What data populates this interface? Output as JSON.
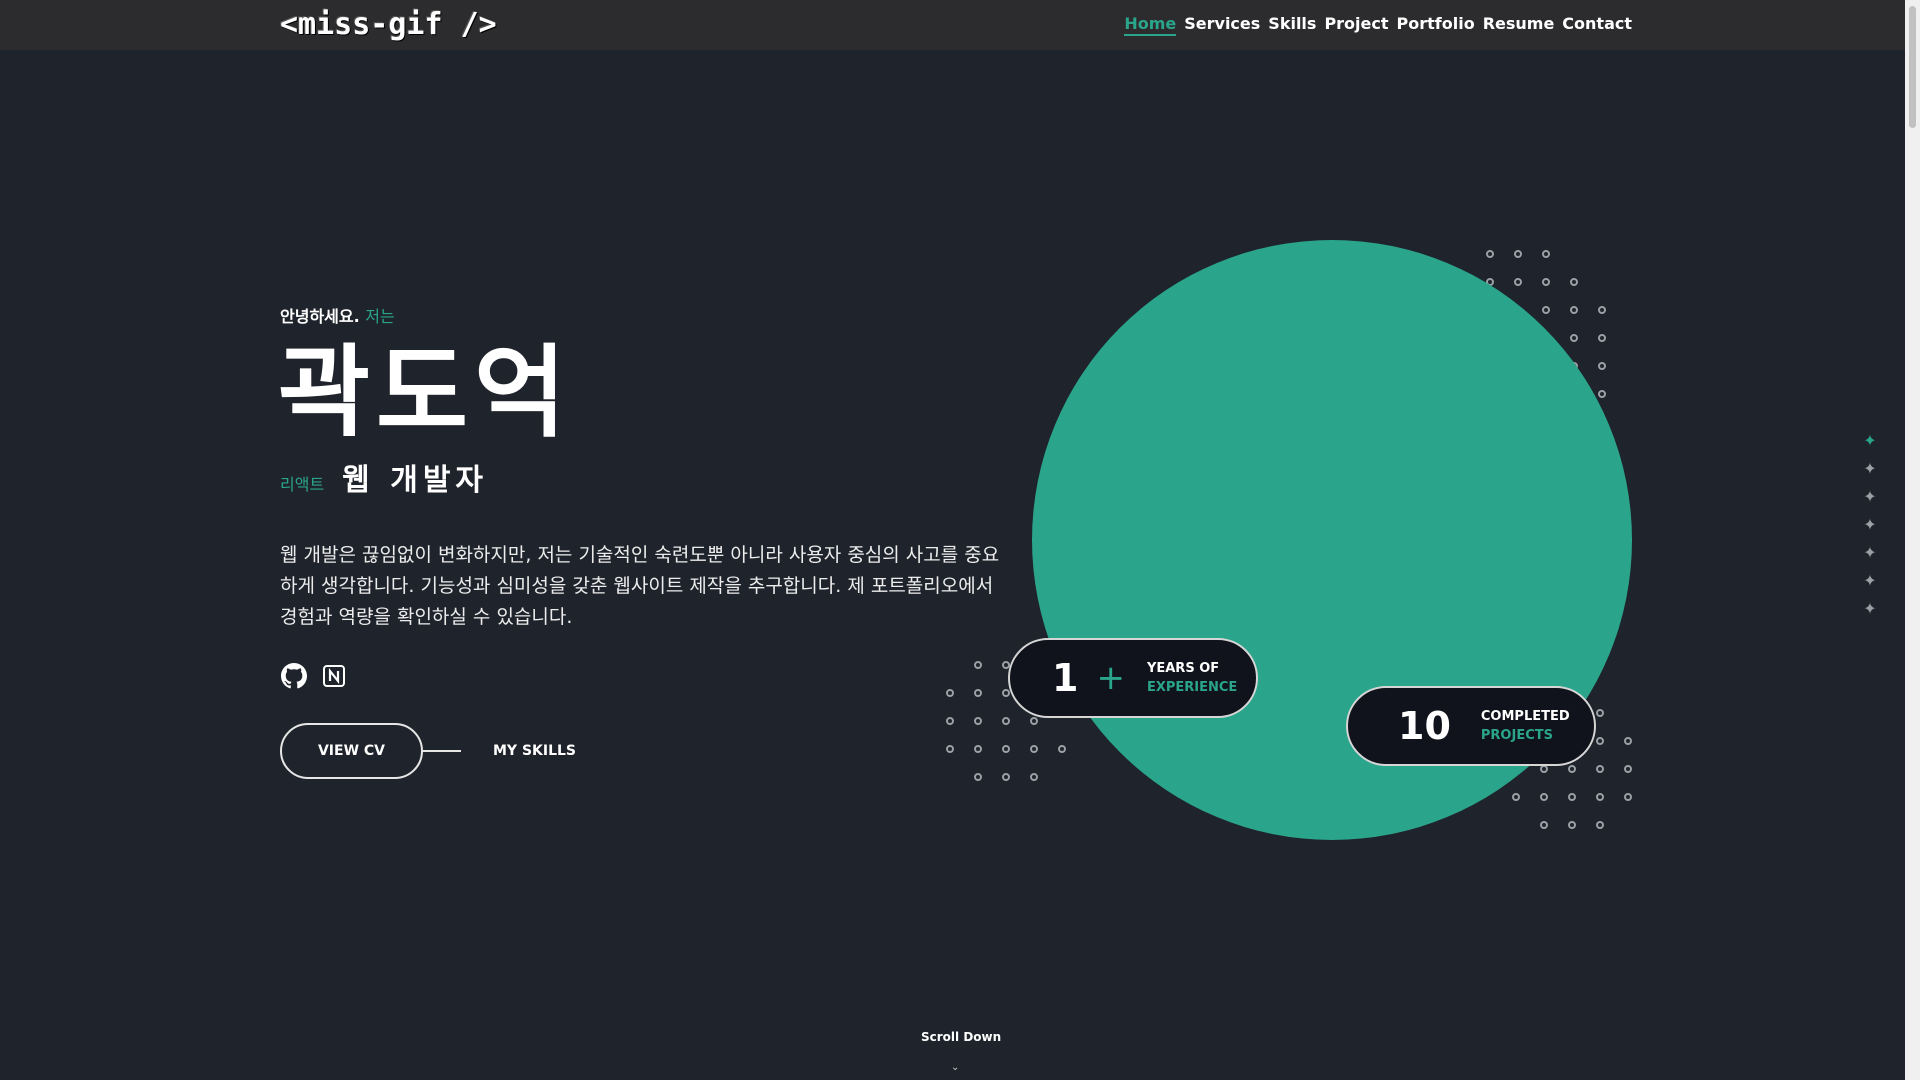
{
  "nav": {
    "logo": "<miss-gif />",
    "links": [
      "Home",
      "Services",
      "Skills",
      "Project",
      "Portfolio",
      "Resume",
      "Contact"
    ]
  },
  "hero": {
    "greeting": "안녕하세요.",
    "greeting_accent": "저는",
    "name": "곽도억",
    "role_small": "리액트",
    "role_main": "웹 개발자",
    "description": "웹 개발은 끊임없이 변화하지만, 저는 기술적인 숙련도뿐 아니라 사용자 중심의 사고를 중요하게 생각합니다. 기능성과 심미성을 갖춘 웹사이트 제작을 추구합니다. 제 포트폴리오에서 경험과 역량을 확인하실 수 있습니다.",
    "view_cv": "VIEW CV",
    "my_skills": "MY SKILLS"
  },
  "stats": {
    "experience": {
      "num": "1",
      "plus": "+",
      "top": "YEARS OF",
      "bottom": "EXPERIENCE"
    },
    "projects": {
      "num": "10",
      "top": "COMPLETED",
      "bottom": "PROJECTS"
    }
  },
  "scroll_down": "Scroll Down",
  "colors": {
    "accent": "#2aa58b",
    "background": "#1f232b",
    "nav": "#2c2c2f"
  },
  "icons": [
    "github-icon",
    "notion-icon",
    "star-icon",
    "chevron-down-icon"
  ]
}
